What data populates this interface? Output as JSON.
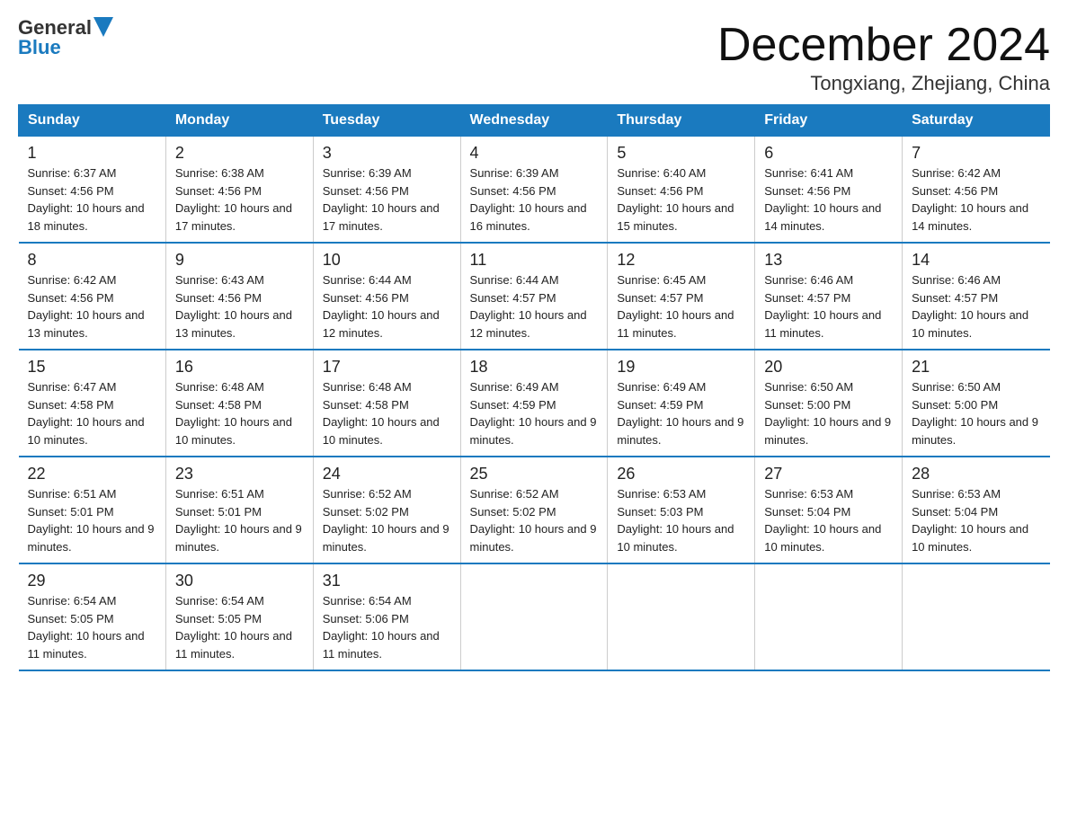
{
  "header": {
    "logo_general": "General",
    "logo_blue": "Blue",
    "month_title": "December 2024",
    "location": "Tongxiang, Zhejiang, China"
  },
  "days_of_week": [
    "Sunday",
    "Monday",
    "Tuesday",
    "Wednesday",
    "Thursday",
    "Friday",
    "Saturday"
  ],
  "weeks": [
    [
      {
        "day": "1",
        "sunrise": "6:37 AM",
        "sunset": "4:56 PM",
        "daylight": "10 hours and 18 minutes."
      },
      {
        "day": "2",
        "sunrise": "6:38 AM",
        "sunset": "4:56 PM",
        "daylight": "10 hours and 17 minutes."
      },
      {
        "day": "3",
        "sunrise": "6:39 AM",
        "sunset": "4:56 PM",
        "daylight": "10 hours and 17 minutes."
      },
      {
        "day": "4",
        "sunrise": "6:39 AM",
        "sunset": "4:56 PM",
        "daylight": "10 hours and 16 minutes."
      },
      {
        "day": "5",
        "sunrise": "6:40 AM",
        "sunset": "4:56 PM",
        "daylight": "10 hours and 15 minutes."
      },
      {
        "day": "6",
        "sunrise": "6:41 AM",
        "sunset": "4:56 PM",
        "daylight": "10 hours and 14 minutes."
      },
      {
        "day": "7",
        "sunrise": "6:42 AM",
        "sunset": "4:56 PM",
        "daylight": "10 hours and 14 minutes."
      }
    ],
    [
      {
        "day": "8",
        "sunrise": "6:42 AM",
        "sunset": "4:56 PM",
        "daylight": "10 hours and 13 minutes."
      },
      {
        "day": "9",
        "sunrise": "6:43 AM",
        "sunset": "4:56 PM",
        "daylight": "10 hours and 13 minutes."
      },
      {
        "day": "10",
        "sunrise": "6:44 AM",
        "sunset": "4:56 PM",
        "daylight": "10 hours and 12 minutes."
      },
      {
        "day": "11",
        "sunrise": "6:44 AM",
        "sunset": "4:57 PM",
        "daylight": "10 hours and 12 minutes."
      },
      {
        "day": "12",
        "sunrise": "6:45 AM",
        "sunset": "4:57 PM",
        "daylight": "10 hours and 11 minutes."
      },
      {
        "day": "13",
        "sunrise": "6:46 AM",
        "sunset": "4:57 PM",
        "daylight": "10 hours and 11 minutes."
      },
      {
        "day": "14",
        "sunrise": "6:46 AM",
        "sunset": "4:57 PM",
        "daylight": "10 hours and 10 minutes."
      }
    ],
    [
      {
        "day": "15",
        "sunrise": "6:47 AM",
        "sunset": "4:58 PM",
        "daylight": "10 hours and 10 minutes."
      },
      {
        "day": "16",
        "sunrise": "6:48 AM",
        "sunset": "4:58 PM",
        "daylight": "10 hours and 10 minutes."
      },
      {
        "day": "17",
        "sunrise": "6:48 AM",
        "sunset": "4:58 PM",
        "daylight": "10 hours and 10 minutes."
      },
      {
        "day": "18",
        "sunrise": "6:49 AM",
        "sunset": "4:59 PM",
        "daylight": "10 hours and 9 minutes."
      },
      {
        "day": "19",
        "sunrise": "6:49 AM",
        "sunset": "4:59 PM",
        "daylight": "10 hours and 9 minutes."
      },
      {
        "day": "20",
        "sunrise": "6:50 AM",
        "sunset": "5:00 PM",
        "daylight": "10 hours and 9 minutes."
      },
      {
        "day": "21",
        "sunrise": "6:50 AM",
        "sunset": "5:00 PM",
        "daylight": "10 hours and 9 minutes."
      }
    ],
    [
      {
        "day": "22",
        "sunrise": "6:51 AM",
        "sunset": "5:01 PM",
        "daylight": "10 hours and 9 minutes."
      },
      {
        "day": "23",
        "sunrise": "6:51 AM",
        "sunset": "5:01 PM",
        "daylight": "10 hours and 9 minutes."
      },
      {
        "day": "24",
        "sunrise": "6:52 AM",
        "sunset": "5:02 PM",
        "daylight": "10 hours and 9 minutes."
      },
      {
        "day": "25",
        "sunrise": "6:52 AM",
        "sunset": "5:02 PM",
        "daylight": "10 hours and 9 minutes."
      },
      {
        "day": "26",
        "sunrise": "6:53 AM",
        "sunset": "5:03 PM",
        "daylight": "10 hours and 10 minutes."
      },
      {
        "day": "27",
        "sunrise": "6:53 AM",
        "sunset": "5:04 PM",
        "daylight": "10 hours and 10 minutes."
      },
      {
        "day": "28",
        "sunrise": "6:53 AM",
        "sunset": "5:04 PM",
        "daylight": "10 hours and 10 minutes."
      }
    ],
    [
      {
        "day": "29",
        "sunrise": "6:54 AM",
        "sunset": "5:05 PM",
        "daylight": "10 hours and 11 minutes."
      },
      {
        "day": "30",
        "sunrise": "6:54 AM",
        "sunset": "5:05 PM",
        "daylight": "10 hours and 11 minutes."
      },
      {
        "day": "31",
        "sunrise": "6:54 AM",
        "sunset": "5:06 PM",
        "daylight": "10 hours and 11 minutes."
      },
      null,
      null,
      null,
      null
    ]
  ]
}
